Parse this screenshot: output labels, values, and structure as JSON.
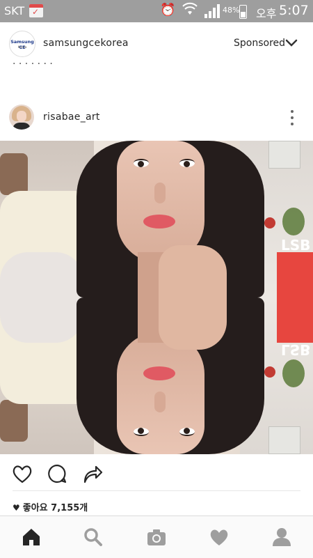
{
  "status_bar": {
    "carrier": "SKT",
    "battery": "48%",
    "ampm": "오후",
    "time": "5:07",
    "icons": [
      "calendar-notification-icon",
      "alarm-icon",
      "wifi-icon",
      "signal-icon",
      "battery-icon"
    ]
  },
  "sponsored_post": {
    "avatar_text_line1": "Samsung CE",
    "avatar_text_line2": "Korea",
    "username": "samsungcekorea",
    "label": "Sponsored",
    "menu_icon": "chevron-down-icon"
  },
  "post": {
    "username": "risabae_art",
    "more_icon": "vertical-ellipsis-icon",
    "photo_sign_text": "LSB",
    "likes_text": "좋아요 7,155개",
    "actions": [
      "heart-icon",
      "comment-icon",
      "share-icon"
    ]
  },
  "bottom_nav": {
    "tabs": [
      "home-icon",
      "search-icon",
      "camera-icon",
      "activity-heart-icon",
      "profile-icon"
    ],
    "active_tab": "home-icon"
  },
  "colors": {
    "status_bar": "#9e9e9e",
    "text": "#262626",
    "lip": "#e05a63",
    "sign_red": "#e7463f"
  }
}
